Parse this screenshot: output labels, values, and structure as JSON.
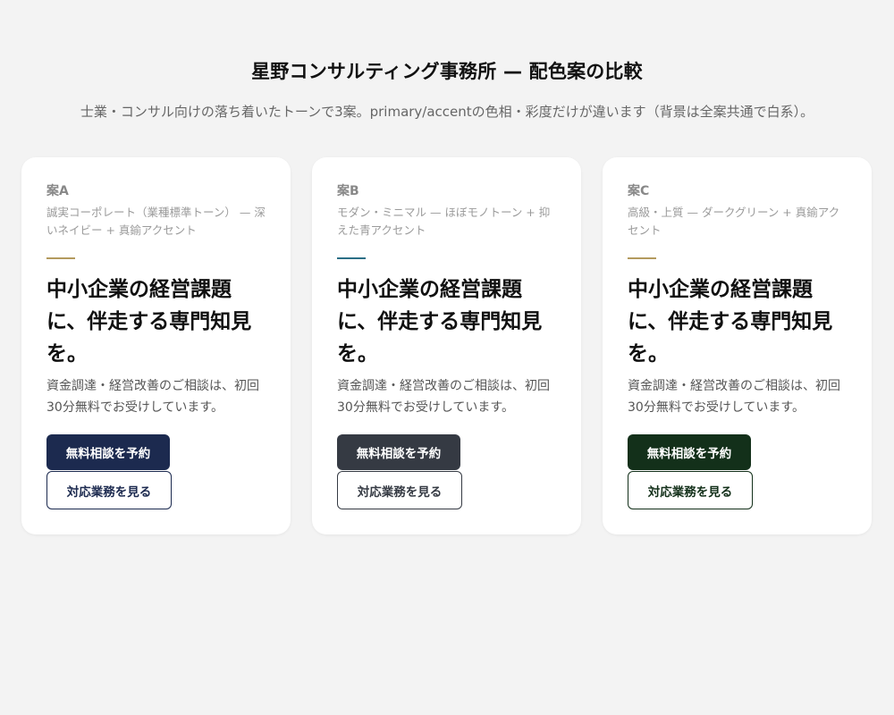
{
  "page": {
    "title": "星野コンサルティング事務所 — 配色案の比較",
    "subtitle": "士業・コンサル向けの落ち着いたトーンで3案。primary/accentの色相・彩度だけが違います（背景は全案共通で白系）。"
  },
  "cards": [
    {
      "label": "案A",
      "description": "誠実コーポレート（業種標準トーン） — 深いネイビー + 真鍮アクセント",
      "headline": "中小企業の経営課題に、伴走する専門知見を。",
      "body": "資金調達・経営改善のご相談は、初回30分無料でお受けしています。",
      "primary_button": "無料相談を予約",
      "secondary_button": "対応業務を見る",
      "colors": {
        "primary": "#1c2a4f",
        "accent": "#b39a5e"
      }
    },
    {
      "label": "案B",
      "description": "モダン・ミニマル — ほぼモノトーン + 抑えた青アクセント",
      "headline": "中小企業の経営課題に、伴走する専門知見を。",
      "body": "資金調達・経営改善のご相談は、初回30分無料でお受けしています。",
      "primary_button": "無料相談を予約",
      "secondary_button": "対応業務を見る",
      "colors": {
        "primary": "#353a43",
        "accent": "#2b6f86"
      }
    },
    {
      "label": "案C",
      "description": "高級・上質 — ダークグリーン + 真鍮アクセント",
      "headline": "中小企業の経営課題に、伴走する専門知見を。",
      "body": "資金調達・経営改善のご相談は、初回30分無料でお受けしています。",
      "primary_button": "無料相談を予約",
      "secondary_button": "対応業務を見る",
      "colors": {
        "primary": "#13301a",
        "accent": "#b39a5e"
      }
    }
  ]
}
